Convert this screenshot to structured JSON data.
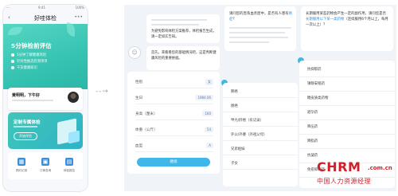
{
  "phone": {
    "status": {
      "carrier": "···",
      "time": "9:41",
      "battery": "100%"
    },
    "title": "好哇体检",
    "banner": {
      "title": "5分钟检前评估",
      "bullets": [
        "5分钟了解健康风险",
        "针对性推选检测项目",
        "干货健康知识"
      ]
    },
    "greeting": "黄明明，下午好",
    "plan": {
      "title": "定制专属体检",
      "button": "开始评估"
    },
    "shortcuts": [
      "预约记录",
      "订单查询",
      "体检报告"
    ]
  },
  "flow_arrow": "- - →",
  "chat": {
    "intro_msg": "为避免影响体检方案推荐，体检报告生成，请一定如实告知。",
    "bot_msg": "首先，来看看您的基础情况吧，这是判断健康风险的重要依据。",
    "fields": [
      {
        "label": "性别",
        "value": "女"
      },
      {
        "label": "生日",
        "value": "1984.06"
      },
      {
        "label": "身高（厘米）",
        "value": "160"
      },
      {
        "label": "体重（公斤）",
        "value": "54"
      },
      {
        "label": "血型",
        "value": "A"
      }
    ],
    "submit": "继续"
  },
  "q2": {
    "question_pre": "请问您的直系血亲屋中，是否有人患有",
    "question_hl": "癌症",
    "question_post": "？",
    "options": [
      "肺癌",
      "肠癌",
      "甲亢/肝癌（有记录）",
      "外公/外婆（外祖父母）",
      "兄弟姐妹",
      "子女"
    ]
  },
  "q3": {
    "question_pre": "长期服用某些药物会产生一定的副作用，请问您是否",
    "question_hl": "长期服用以下某一类药物",
    "question_post": "（连续服用6个月以上，每月一次以上）？",
    "options": [
      "抗抑郁药",
      "镇静安眠药",
      "糖皮质类药物",
      "避孕药",
      "降压药",
      "降脂药",
      "抗凝药",
      "免疫抑制药"
    ]
  },
  "watermark": {
    "logo": "CHRM",
    "suffix": ".com.cn",
    "cn": "中国人力资源经理"
  }
}
